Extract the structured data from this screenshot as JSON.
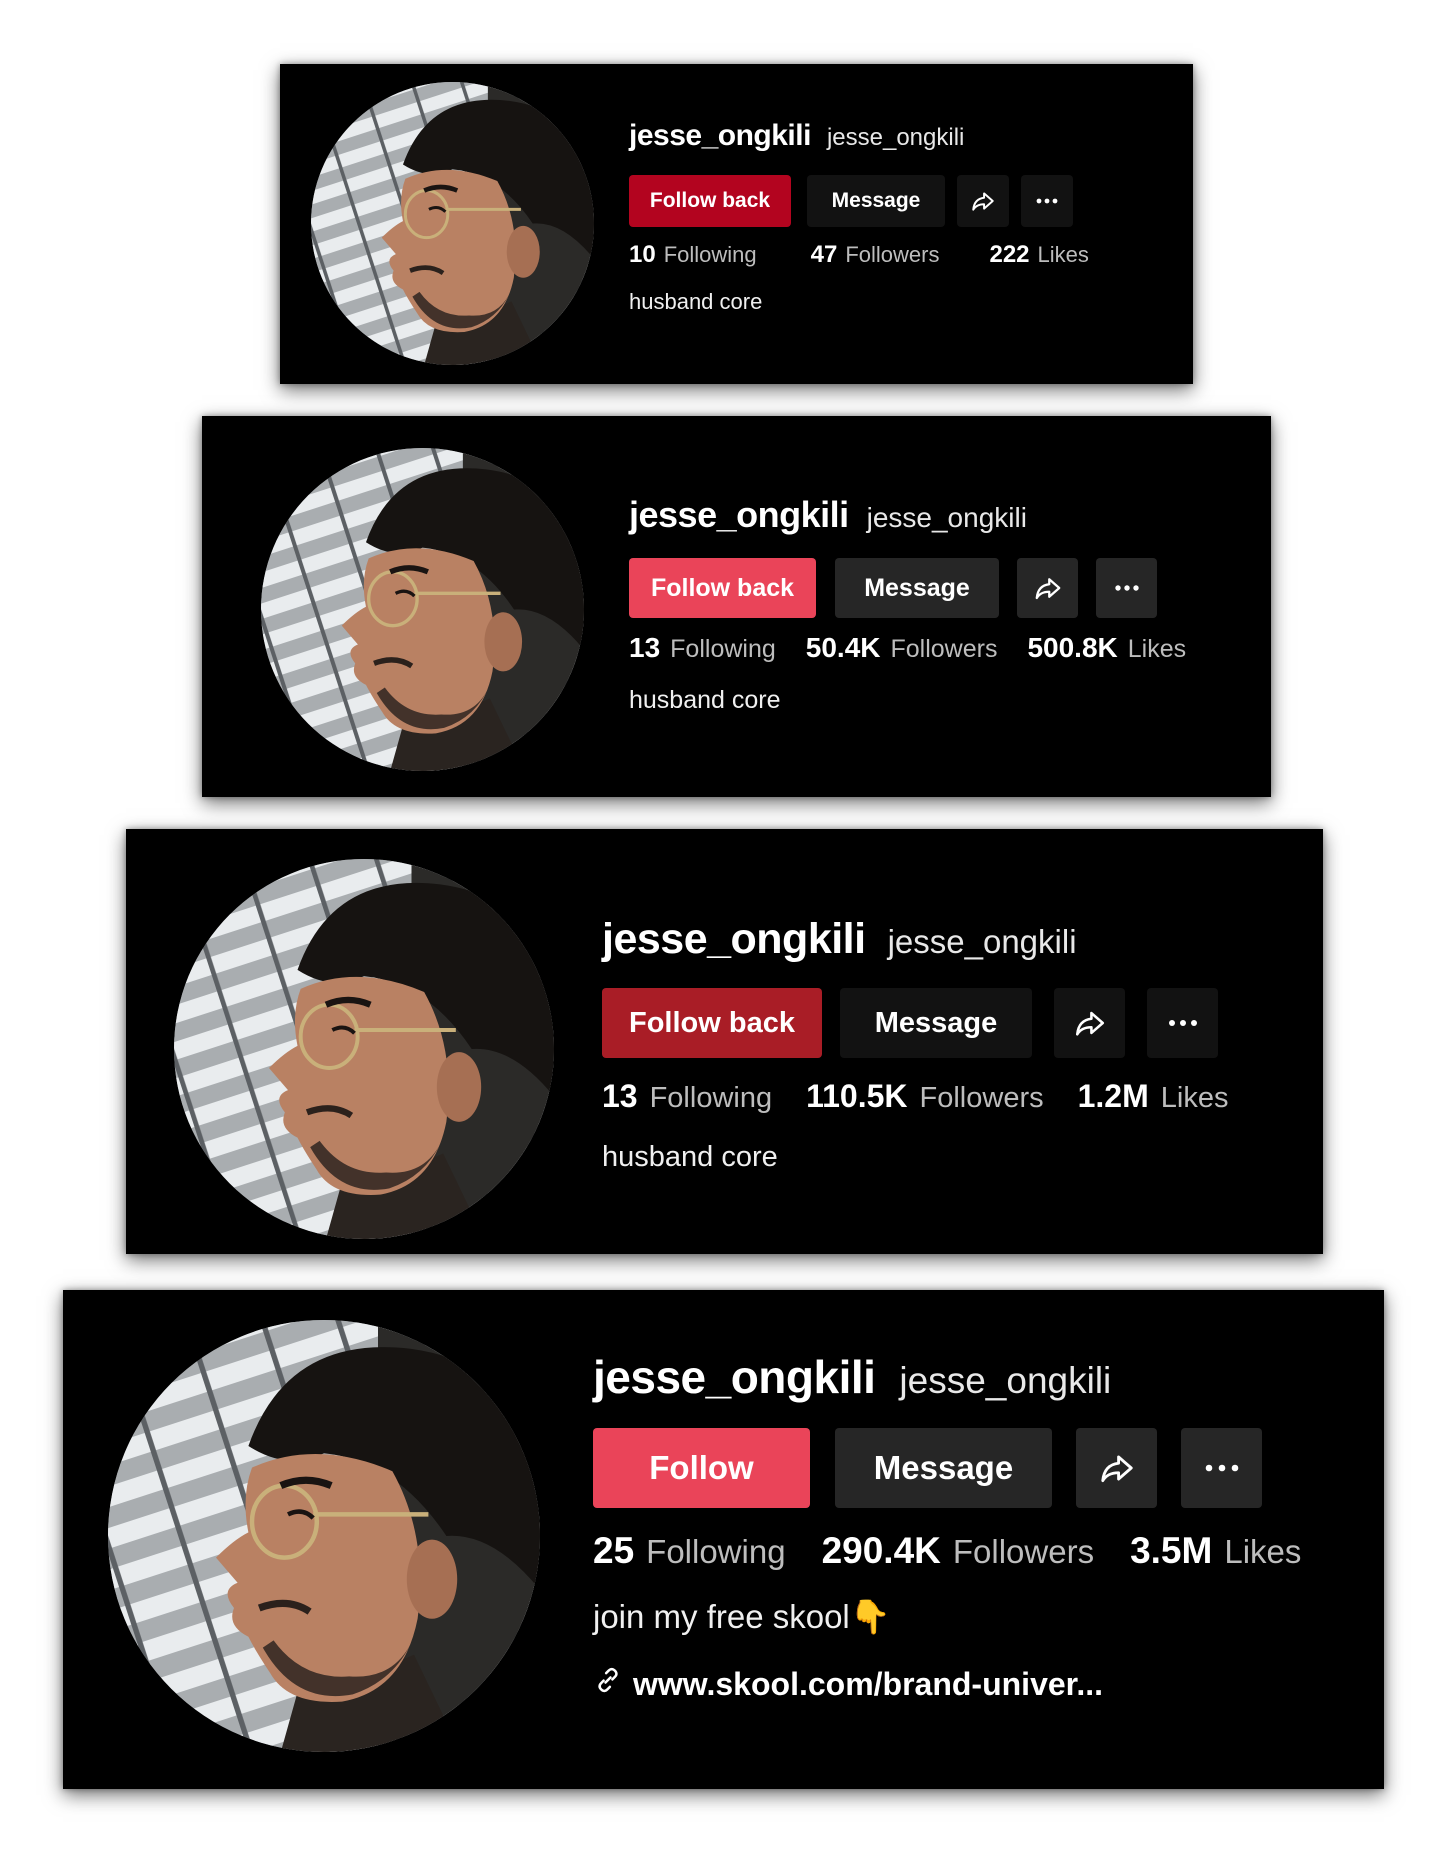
{
  "profiles": [
    {
      "display_name": "jesse_ongkili",
      "handle": "jesse_ongkili",
      "follow_label": "Follow back",
      "message_label": "Message",
      "following_count": "10",
      "following_label": "Following",
      "followers_count": "47",
      "followers_label": "Followers",
      "likes_count": "222",
      "likes_label": "Likes",
      "bio": "husband core",
      "follow_color": "#b3041f"
    },
    {
      "display_name": "jesse_ongkili",
      "handle": "jesse_ongkili",
      "follow_label": "Follow back",
      "message_label": "Message",
      "following_count": "13",
      "following_label": "Following",
      "followers_count": "50.4K",
      "followers_label": "Followers",
      "likes_count": "500.8K",
      "likes_label": "Likes",
      "bio": "husband core",
      "follow_color": "#ea4459"
    },
    {
      "display_name": "jesse_ongkili",
      "handle": "jesse_ongkili",
      "follow_label": "Follow back",
      "message_label": "Message",
      "following_count": "13",
      "following_label": "Following",
      "followers_count": "110.5K",
      "followers_label": "Followers",
      "likes_count": "1.2M",
      "likes_label": "Likes",
      "bio": "husband core",
      "follow_color": "#a91d26"
    },
    {
      "display_name": "jesse_ongkili",
      "handle": "jesse_ongkili",
      "follow_label": "Follow",
      "message_label": "Message",
      "following_count": "25",
      "following_label": "Following",
      "followers_count": "290.4K",
      "followers_label": "Followers",
      "likes_count": "3.5M",
      "likes_label": "Likes",
      "bio": "join my free skool👇",
      "link": "www.skool.com/brand-univer...",
      "follow_color": "#ea4459"
    }
  ],
  "icons": {
    "share": "share-arrow-icon",
    "more": "more-dots-icon",
    "link": "link-icon"
  }
}
